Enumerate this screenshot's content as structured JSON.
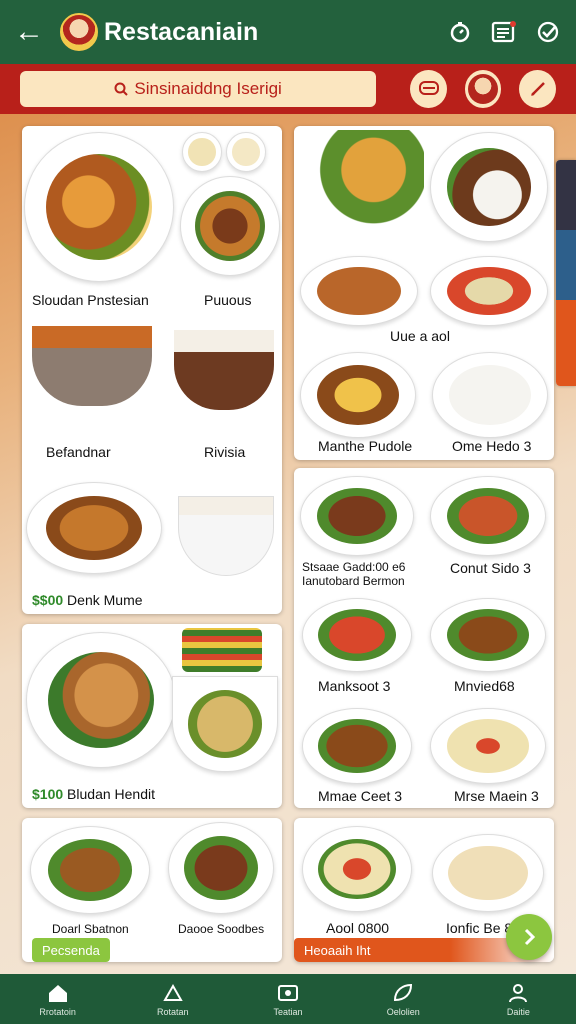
{
  "header": {
    "title": "Restacaniain"
  },
  "search": {
    "text": "Sinsinaiddng Iserigi"
  },
  "cards": {
    "c1": {
      "l1": "Sloudan Pnstesian",
      "l2": "Puuous",
      "l3": "Befandnar",
      "l4": "Rivisia",
      "price": "$$00",
      "l5": "Denk Mume"
    },
    "c2": {
      "price": "$100",
      "l1": "Bludan Hendit"
    },
    "c3": {
      "l1": "Uue a aol",
      "l2": "Manthe Pudole",
      "l3": "Ome Hedo 3"
    },
    "c4": {
      "l1": "Stsaae Gadd:00 e6",
      "l1b": "Ianutobard Bermon",
      "l2": "Conut Sido 3",
      "l3": "Manksoot 3",
      "l4": "Mnvied68",
      "l5": "Mmae Ceet 3",
      "l6": "Mrse Maein 3"
    },
    "c5": {
      "l1": "Doarl Sbatnon",
      "l2": "Daooe Soodbes",
      "tag": "Pecsenda"
    },
    "c6": {
      "l1": "Aool 0800",
      "l2": "Ionfic Be 80",
      "tag": "Heoaaih Iht"
    }
  },
  "nav": [
    {
      "label": "Rrotatoin"
    },
    {
      "label": "Rotatan"
    },
    {
      "label": "Teatian"
    },
    {
      "label": "Oelolien"
    },
    {
      "label": "Daitie"
    }
  ],
  "colors": {
    "header": "#23613d",
    "searchbar": "#b8201a",
    "nav": "#1f5a38",
    "accent": "#8cc63f"
  }
}
